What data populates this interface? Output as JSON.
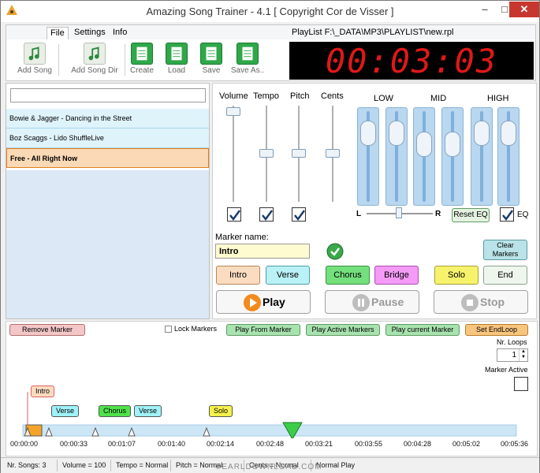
{
  "window": {
    "title": "Amazing Song Trainer - 4.1  [ Copyright Cor de Visser ]",
    "min": "–",
    "max": "□",
    "close": "✕"
  },
  "ribbon": {
    "tabs": [
      {
        "label": "File"
      },
      {
        "label": "Settings"
      },
      {
        "label": "Info"
      }
    ],
    "playlist_path": "PlayList F:\\_DATA\\MP3\\PLAYLIST\\new.rpl",
    "buttons": [
      {
        "label": "Add Song",
        "icon": "note-icon"
      },
      {
        "label": "Add Song Dir",
        "icon": "note-folder-icon"
      },
      {
        "label": "Create",
        "icon": "create-list-icon"
      },
      {
        "label": "Load",
        "icon": "load-list-icon"
      },
      {
        "label": "Save",
        "icon": "save-list-icon"
      },
      {
        "label": "Save As..",
        "icon": "save-as-list-icon"
      }
    ]
  },
  "timer": "00:03:03",
  "colors": {
    "lcd": "#e01818",
    "accent_green": "#2fa84a",
    "play_orange": "#f28a1c"
  },
  "songs": [
    {
      "title": "Bowie & Jagger - Dancing in the Street"
    },
    {
      "title": "Boz Scaggs - Lido ShuffleLive"
    },
    {
      "title": "Free - All Right Now"
    }
  ],
  "selected_song": "Free - All Right Now",
  "search": {
    "value": "",
    "placeholder": ""
  },
  "sliders": {
    "volume": "Volume",
    "tempo": "Tempo",
    "pitch": "Pitch",
    "cents": "Cents"
  },
  "eq": {
    "low": "LOW",
    "mid": "MID",
    "high": "HIGH",
    "bal_left": "L",
    "bal_right": "R",
    "reset": "Reset EQ",
    "eq_label": "EQ"
  },
  "marker_name": {
    "label": "Marker name:",
    "value": "Intro"
  },
  "clear_markers": "Clear Markers",
  "markers": {
    "intro": "Intro",
    "verse": "Verse",
    "chorus": "Chorus",
    "bridge": "Bridge",
    "solo": "Solo",
    "end": "End"
  },
  "transport": {
    "play": "Play",
    "pause": "Pause",
    "stop": "Stop"
  },
  "timeline_bar": {
    "remove": "Remove Marker",
    "lock": "Lock Markers",
    "play_from": "Play From Marker",
    "play_active": "Play Active Markers",
    "play_current": "Play current Marker",
    "set_endloop": "Set EndLoop",
    "nr_loops_label": "Nr. Loops",
    "nr_loops": "1",
    "marker_active": "Marker Active"
  },
  "timeline_markers": [
    {
      "label": "Intro"
    },
    {
      "label": "Verse"
    },
    {
      "label": "Chorus"
    },
    {
      "label": "Verse"
    },
    {
      "label": "Solo"
    }
  ],
  "ticks": [
    "00:00:00",
    "00:00:33",
    "00:01:07",
    "00:01:40",
    "00:02:14",
    "00:02:48",
    "00:03:21",
    "00:03:55",
    "00:04:28",
    "00:05:02",
    "00:05:36"
  ],
  "status": {
    "songs": "Nr. Songs: 3",
    "volume": "Volume = 100",
    "tempo": "Tempo = Normal",
    "pitch": "Pitch = Normal",
    "cents": "Cents = Normal",
    "mode": "Normal Play"
  },
  "watermark": "©EARLDOWNLOAD.COM"
}
